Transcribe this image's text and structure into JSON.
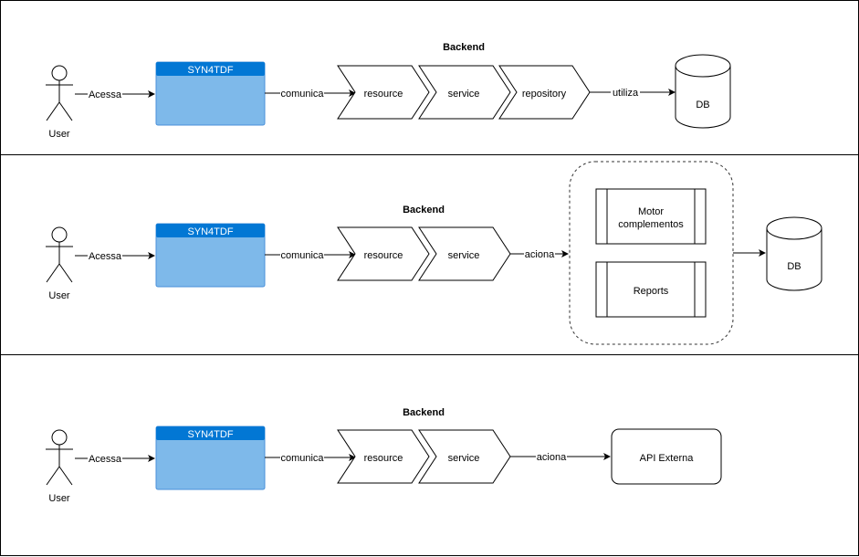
{
  "diagram": {
    "lanes": [
      {
        "id": "lane-1",
        "title": "Backend",
        "actor": "User",
        "actor_edge": "Acessa",
        "app": "SYN4TDF",
        "app_edge": "comunica",
        "steps": [
          "resource",
          "service",
          "repository"
        ],
        "out_edge": "utiliza",
        "target": {
          "type": "database",
          "label": "DB"
        }
      },
      {
        "id": "lane-2",
        "title": "Backend",
        "actor": "User",
        "actor_edge": "Acessa",
        "app": "SYN4TDF",
        "app_edge": "comunica",
        "steps": [
          "resource",
          "service"
        ],
        "out_edge": "aciona",
        "group": [
          "Motor complementos",
          "Reports"
        ],
        "target": {
          "type": "database",
          "label": "DB"
        }
      },
      {
        "id": "lane-3",
        "title": "Backend",
        "actor": "User",
        "actor_edge": "Acessa",
        "app": "SYN4TDF",
        "app_edge": "comunica",
        "steps": [
          "resource",
          "service"
        ],
        "out_edge": "aciona",
        "target": {
          "type": "process",
          "label": "API Externa"
        }
      }
    ],
    "colors": {
      "app_header": "#0277d4",
      "app_body": "#7eb9ea",
      "app_border": "#4a90d9",
      "line": "#000000",
      "dashed_group": "#333333"
    }
  }
}
